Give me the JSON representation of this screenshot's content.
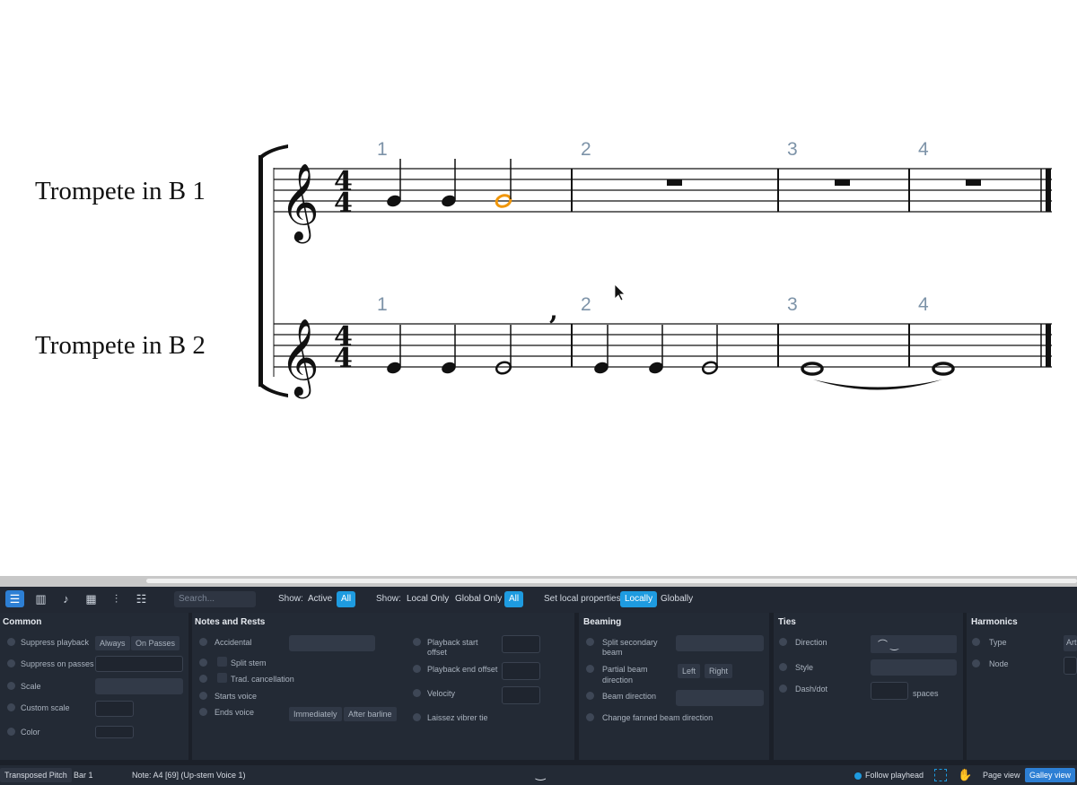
{
  "score": {
    "staff1_name": "Trompete in B 1",
    "staff2_name": "Trompete in B 2",
    "bar_numbers": [
      "1",
      "2",
      "3",
      "4"
    ],
    "selected_note_color": "#f0960a",
    "bar_number_color": "#7d93a8"
  },
  "toolbar": {
    "icons": [
      "list-icon",
      "piano-icon",
      "guitar-icon",
      "grid-icon",
      "mixer-icon",
      "filter-icon"
    ],
    "search_placeholder": "Search...",
    "show_label_1": "Show:",
    "active": "Active",
    "all_1": "All",
    "show_label_2": "Show:",
    "local_only": "Local Only",
    "global_only": "Global Only",
    "all_2": "All",
    "set_local_label": "Set local properties:",
    "locally": "Locally",
    "globally": "Globally"
  },
  "groups": {
    "common": {
      "title": "Common",
      "suppress_playback": "Suppress playback",
      "always": "Always",
      "on_passes": "On Passes",
      "suppress_on_passes": "Suppress on passes",
      "scale": "Scale",
      "custom_scale": "Custom scale",
      "color": "Color"
    },
    "notes": {
      "title": "Notes and Rests",
      "accidental": "Accidental",
      "split_stem": "Split stem",
      "trad_cancellation": "Trad. cancellation",
      "starts_voice": "Starts voice",
      "ends_voice": "Ends voice",
      "immediately": "Immediately",
      "after_barline": "After barline",
      "playback_start_offset": "Playback start",
      "playback_start_offset_2": "offset",
      "playback_end_offset": "Playback end offset",
      "velocity": "Velocity",
      "laissez_vibrer": "Laissez vibrer tie"
    },
    "beaming": {
      "title": "Beaming",
      "split_secondary": "Split secondary",
      "split_secondary_2": "beam",
      "partial_beam": "Partial beam",
      "partial_beam_2": "direction",
      "left": "Left",
      "right": "Right",
      "beam_direction": "Beam direction",
      "change_fanned": "Change fanned beam direction"
    },
    "ties": {
      "title": "Ties",
      "direction": "Direction",
      "style": "Style",
      "dash_dot": "Dash/dot",
      "spaces": "spaces"
    },
    "harmonics": {
      "title": "Harmonics",
      "type": "Type",
      "node": "Node",
      "type_value": "Art"
    }
  },
  "statusbar": {
    "transposed_pitch": "Transposed Pitch",
    "bar": "Bar 1",
    "note_info": "Note: A4 [69] (Up-stem Voice 1)",
    "follow_playhead": "Follow playhead",
    "page_view": "Page view",
    "galley_view": "Galley view"
  }
}
